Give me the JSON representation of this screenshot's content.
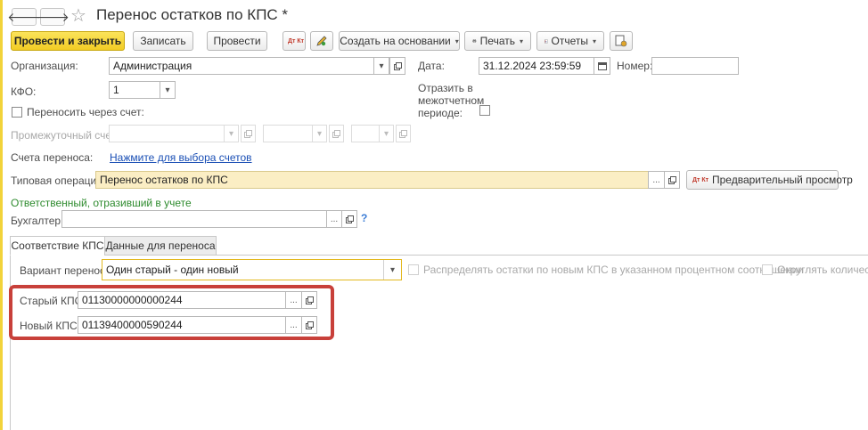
{
  "window": {
    "title": "Перенос остатков по КПС *",
    "nav_back_glyph": "🡐",
    "nav_forward_glyph": "🡒",
    "star_glyph": "☆"
  },
  "toolbar": {
    "post_and_close": "Провести и закрыть",
    "save": "Записать",
    "post": "Провести",
    "create_based_on": "Создать на основании",
    "print": "Печать",
    "reports": "Отчеты",
    "dt_kt_icon_text": "Дт Кт"
  },
  "form": {
    "organization_label": "Организация:",
    "organization_value": "Администрация",
    "date_label": "Дата:",
    "date_value": "31.12.2024 23:59:59",
    "number_label": "Номер:",
    "number_value": "",
    "kfo_label": "КФО:",
    "kfo_value": "1",
    "interim_period_label": "Отразить в межотчетном периоде:",
    "transfer_via_account_label": "Переносить через счет:",
    "intermediate_account_label": "Промежуточный счет:",
    "transfer_accounts_label": "Счета переноса:",
    "transfer_accounts_link": "Нажмите для выбора счетов",
    "typical_operation_label": "Типовая операция:",
    "typical_operation_value": "Перенос остатков по КПС",
    "preview_button": "Предварительный просмотр",
    "responsible_header": "Ответственный, отразивший в учете",
    "accountant_label": "Бухгалтер:",
    "accountant_value": "",
    "help_glyph": "?"
  },
  "tabs": {
    "tab1": "Соответствие КПС",
    "tab2": "Данные для переноса"
  },
  "tab_content": {
    "variant_label": "Вариант переноса:",
    "variant_value": "Один старый - один новый",
    "distribute_label": "Распределять остатки по новым КПС в указанном процентном соотношении",
    "round_label": "Округлять количество",
    "old_kps_label": "Старый КПС:",
    "old_kps_value": "01130000000000244",
    "new_kps_label": "Новый КПС:",
    "new_kps_value": "01139400000590244"
  },
  "glyphs": {
    "ellipsis": "...",
    "dropdown": "▾",
    "dropdown_caret": "▾"
  },
  "colors": {
    "primary_button": "#f2cc24",
    "highlight_box": "#c8403a",
    "link": "#1a4fb5",
    "section_header": "#2e8b2e",
    "typical_operation_bg": "#fbeec4"
  }
}
